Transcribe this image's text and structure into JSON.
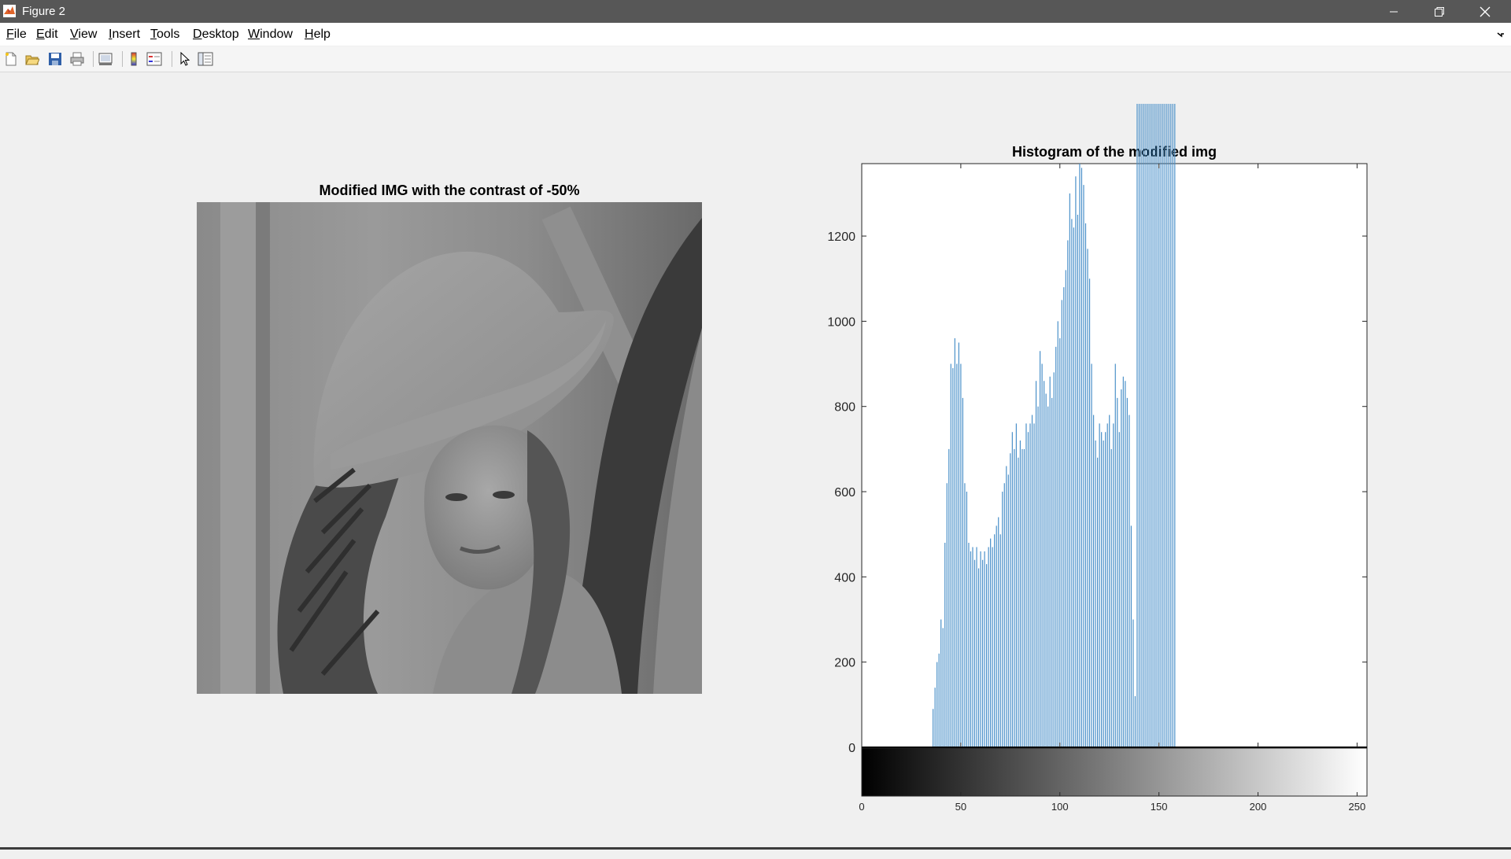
{
  "window": {
    "title": "Figure 2"
  },
  "menu": {
    "items": [
      {
        "ul": "F",
        "rest": "ile"
      },
      {
        "ul": "E",
        "rest": "dit"
      },
      {
        "ul": "V",
        "rest": "iew"
      },
      {
        "ul": "I",
        "rest": "nsert"
      },
      {
        "ul": "T",
        "rest": "ools"
      },
      {
        "ul": "D",
        "rest": "esktop"
      },
      {
        "ul": "W",
        "rest": "indow"
      },
      {
        "ul": "H",
        "rest": "elp"
      }
    ]
  },
  "toolbar": {
    "icons": [
      "new-figure-icon",
      "open-file-icon",
      "save-icon",
      "print-icon",
      "link-plot-icon",
      "insert-colorbar-icon",
      "insert-legend-icon",
      "edit-plot-icon",
      "property-inspector-icon"
    ]
  },
  "image_axes": {
    "title": "Modified IMG with the contrast of -50%"
  },
  "colors": {
    "bar": "#4a90c9",
    "titlebar": "#575757"
  },
  "chart_data": {
    "type": "bar",
    "title": "Histogram of the modified img",
    "xlabel": "",
    "ylabel": "",
    "xlim": [
      0,
      255
    ],
    "ylim": [
      0,
      1370
    ],
    "yticks": [
      0,
      200,
      400,
      600,
      800,
      1000,
      1200
    ],
    "xticks": [
      0,
      50,
      100,
      150,
      200,
      250
    ],
    "colorbar": "grayscale 0-255 below x-axis",
    "x": [
      36,
      37,
      38,
      39,
      40,
      41,
      42,
      43,
      44,
      45,
      46,
      47,
      48,
      49,
      50,
      51,
      52,
      53,
      54,
      55,
      56,
      57,
      58,
      59,
      60,
      61,
      62,
      63,
      64,
      65,
      66,
      67,
      68,
      69,
      70,
      71,
      72,
      73,
      74,
      75,
      76,
      77,
      78,
      79,
      80,
      81,
      82,
      83,
      84,
      85,
      86,
      87,
      88,
      89,
      90,
      91,
      92,
      93,
      94,
      95,
      96,
      97,
      98,
      99,
      100,
      101,
      102,
      103,
      104,
      105,
      106,
      107,
      108,
      109,
      110,
      111,
      112,
      113,
      114,
      115,
      116,
      117,
      118,
      119,
      120,
      121,
      122,
      123,
      124,
      125,
      126,
      127,
      128,
      129,
      130,
      131,
      132,
      133,
      134,
      135,
      136,
      137,
      138,
      139,
      140,
      141,
      142,
      143,
      144,
      145,
      146,
      147,
      148,
      149,
      150,
      151,
      152,
      153,
      154,
      155,
      156,
      157,
      158
    ],
    "values": [
      90,
      140,
      200,
      220,
      300,
      280,
      480,
      620,
      700,
      900,
      890,
      960,
      900,
      950,
      900,
      820,
      620,
      600,
      480,
      460,
      470,
      440,
      470,
      420,
      460,
      440,
      460,
      430,
      470,
      490,
      470,
      500,
      520,
      540,
      500,
      600,
      620,
      660,
      640,
      690,
      740,
      700,
      760,
      680,
      720,
      700,
      700,
      760,
      740,
      760,
      780,
      760,
      860,
      800,
      930,
      900,
      860,
      830,
      800,
      870,
      820,
      880,
      940,
      1000,
      960,
      1050,
      1080,
      1120,
      1190,
      1300,
      1240,
      1220,
      1340,
      1250,
      1370,
      1360,
      1320,
      1230,
      1170,
      1100,
      900,
      780,
      720,
      680,
      760,
      740,
      720,
      740,
      760,
      780,
      700,
      760,
      900,
      820,
      740,
      840,
      870,
      860,
      820,
      780,
      520,
      300,
      120
    ]
  }
}
